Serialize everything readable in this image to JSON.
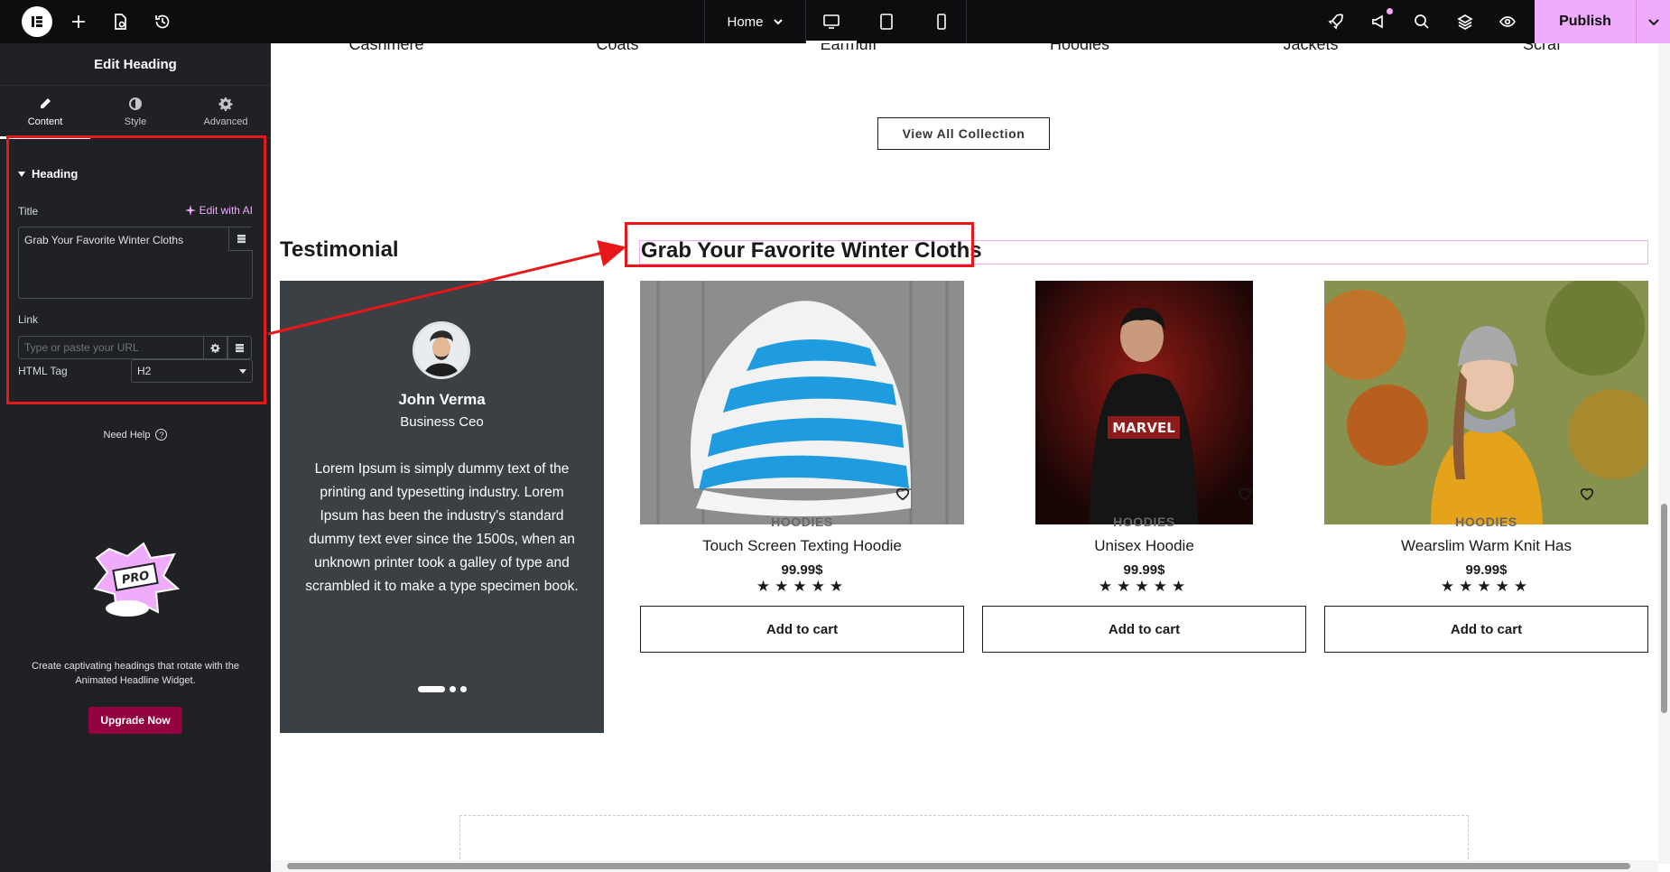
{
  "topbar": {
    "page_name": "Home",
    "publish_label": "Publish",
    "accent_color": "#f0abfc"
  },
  "panel": {
    "header": "Edit Heading",
    "tabs": [
      {
        "label": "Content",
        "icon": "pencil-icon",
        "active": true
      },
      {
        "label": "Style",
        "icon": "half-circle-icon",
        "active": false
      },
      {
        "label": "Advanced",
        "icon": "gear-icon",
        "active": false
      }
    ],
    "section": "Heading",
    "title_label": "Title",
    "ai_label": "Edit with AI",
    "title_value": "Grab Your Favorite Winter Cloths",
    "link_label": "Link",
    "link_placeholder": "Type or paste your URL",
    "tag_label": "HTML Tag",
    "tag_value": "H2",
    "help": "Need Help",
    "promo_text": "Create captivating headings that rotate with the Animated Headline Widget.",
    "upgrade": "Upgrade Now"
  },
  "canvas": {
    "categories": [
      "Cashmere",
      "Coats",
      "Earmuff",
      "Hoodies",
      "Jackets",
      "Scraf"
    ],
    "view_all": "View All Collection",
    "testimonial_title": "Testimonial",
    "testimonial": {
      "name": "John Verma",
      "role": "Business Ceo",
      "body": "Lorem Ipsum is simply dummy text of the printing and typesetting industry. Lorem Ipsum has been the industry's standard dummy text ever since the 1500s, when an unknown printer took a galley of type and scrambled it to make a type specimen book."
    },
    "heading": "Grab Your Favorite Winter Cloths",
    "products": [
      {
        "category": "HOODIES",
        "name": "Touch Screen Texting Hoodie",
        "price": "99.99$",
        "rating": 5,
        "stars": "★★★★★",
        "cart": "Add to cart"
      },
      {
        "category": "HOODIES",
        "name": "Unisex Hoodie",
        "price": "99.99$",
        "rating": 5,
        "stars": "★★★★★",
        "cart": "Add to cart"
      },
      {
        "category": "HOODIES",
        "name": "Wearslim Warm Knit Has",
        "price": "99.99$",
        "rating": 5,
        "stars": "★★★★★",
        "cart": "Add to cart"
      }
    ]
  }
}
